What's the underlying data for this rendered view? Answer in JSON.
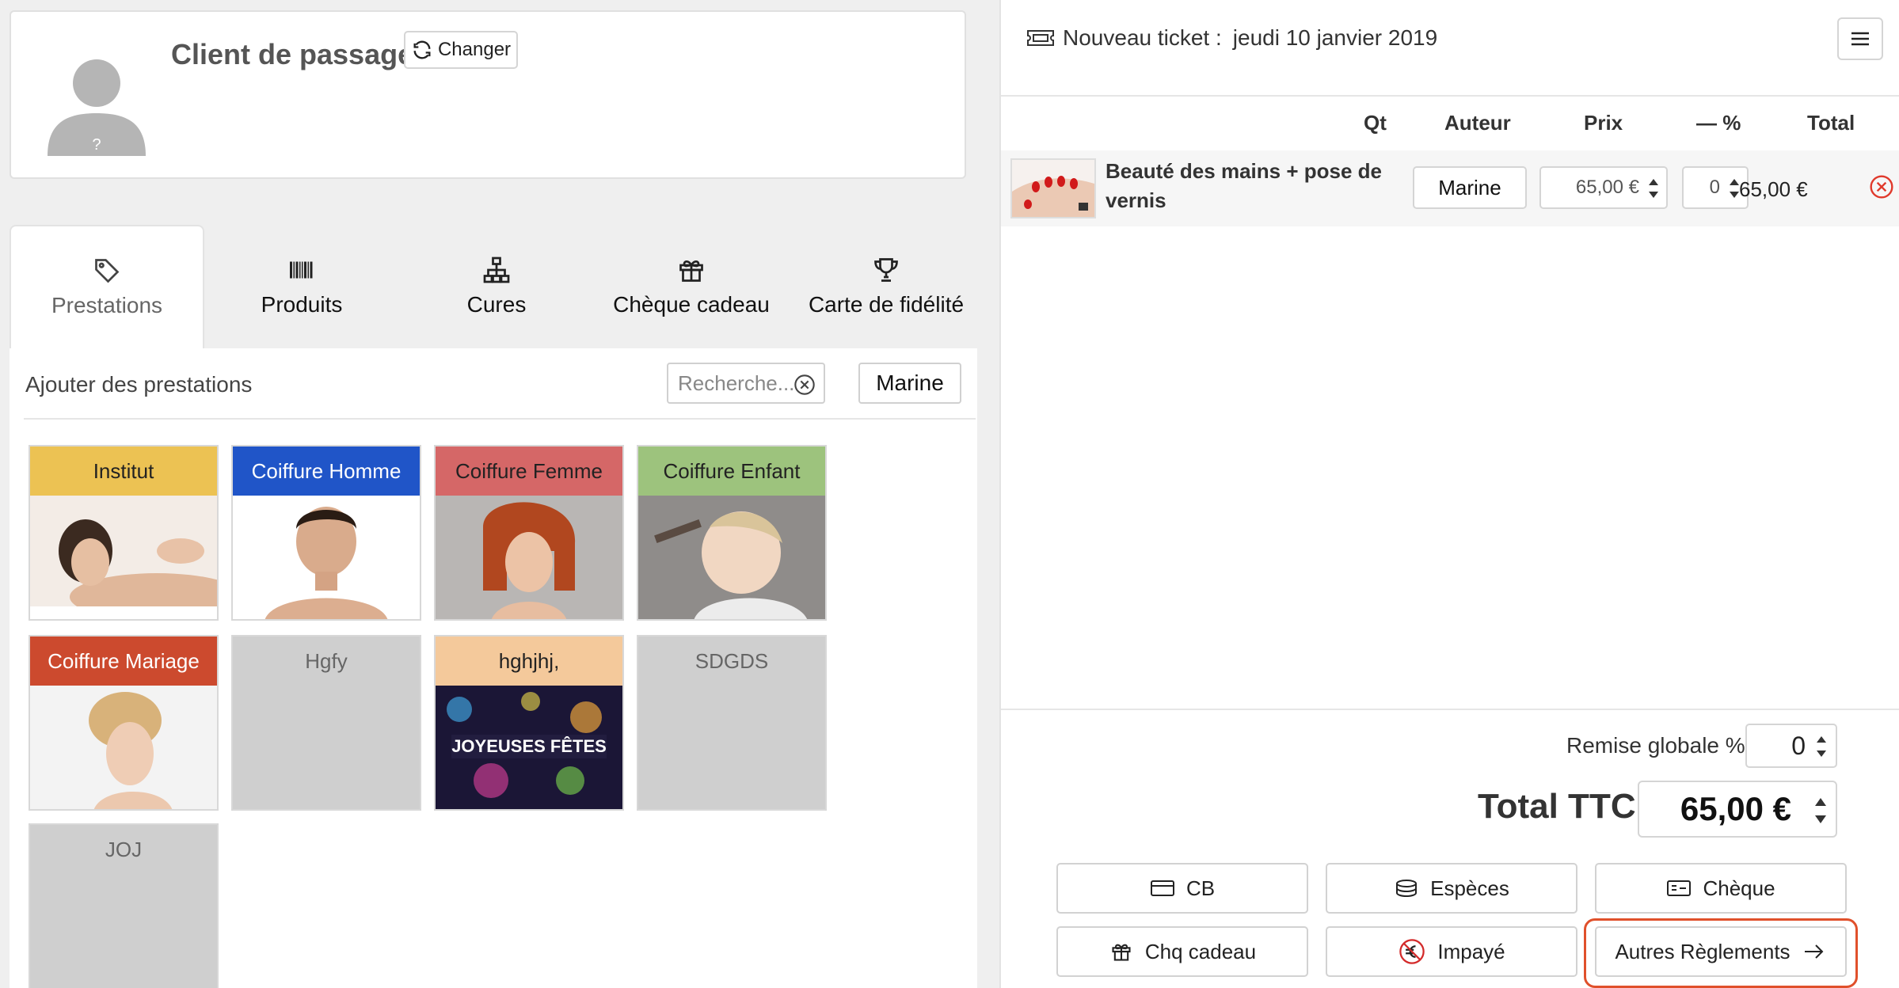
{
  "client": {
    "name": "Client de passage",
    "change_label": "Changer",
    "avatar_mark": "?"
  },
  "tabs": [
    {
      "label": "Prestations",
      "icon": "tag-icon",
      "active": true
    },
    {
      "label": "Produits",
      "icon": "barcode-icon",
      "active": false
    },
    {
      "label": "Cures",
      "icon": "sitemap-icon",
      "active": false
    },
    {
      "label": "Chèque cadeau",
      "icon": "gift-icon",
      "active": false
    },
    {
      "label": "Carte de fidélité",
      "icon": "trophy-icon",
      "active": false
    }
  ],
  "panel": {
    "title": "Ajouter des prestations",
    "search_placeholder": "Recherche...",
    "staff_label": "Marine"
  },
  "categories": [
    {
      "label": "Institut",
      "header_color": "#ecc253",
      "text_color": "#222222",
      "image": "massage-photo"
    },
    {
      "label": "Coiffure Homme",
      "header_color": "#2055c8",
      "text_color": "#ffffff",
      "image": "man-portrait-photo"
    },
    {
      "label": "Coiffure Femme",
      "header_color": "#d56767",
      "text_color": "#222222",
      "image": "woman-red-hair-photo"
    },
    {
      "label": "Coiffure Enfant",
      "header_color": "#9dc37d",
      "text_color": "#222222",
      "image": "child-haircut-photo"
    },
    {
      "label": "Coiffure Mariage",
      "header_color": "#cc4a2e",
      "text_color": "#ffffff",
      "image": "bride-hairstyle-photo"
    },
    {
      "label": "Hgfy",
      "header_color": "",
      "text_color": "#666666",
      "image": ""
    },
    {
      "label": "hghjhj,",
      "header_color": "#f4c99b",
      "text_color": "#222222",
      "image": "joyeuses-fetes-photo"
    },
    {
      "label": "SDGDS",
      "header_color": "",
      "text_color": "#666666",
      "image": ""
    },
    {
      "label": "JOJ",
      "header_color": "",
      "text_color": "#666666",
      "image": ""
    }
  ],
  "ticket": {
    "label": "Nouveau ticket :",
    "date": "jeudi 10 janvier 2019",
    "columns": {
      "qt": "Qt",
      "author": "Auteur",
      "price": "Prix",
      "discount": "— %",
      "total": "Total"
    },
    "lines": [
      {
        "name": "Beauté des mains + pose de vernis",
        "author": "Marine",
        "price": "65,00 €",
        "discount": "0",
        "total": "65,00 €",
        "image": "manicure-photo"
      }
    ]
  },
  "summary": {
    "remise_label": "Remise globale %",
    "remise_value": "0",
    "total_label": "Total TTC",
    "total_value": "65,00 €"
  },
  "payments": [
    {
      "label": "CB",
      "icon": "credit-card-icon"
    },
    {
      "label": "Espèces",
      "icon": "cash-icon"
    },
    {
      "label": "Chèque",
      "icon": "cheque-icon"
    },
    {
      "label": "Chq cadeau",
      "icon": "gift-icon"
    },
    {
      "label": "Impayé",
      "icon": "no-euro-icon"
    },
    {
      "label": "Autres Règlements",
      "icon": "arrow-right-icon",
      "highlight_color": "#e0502b"
    }
  ]
}
